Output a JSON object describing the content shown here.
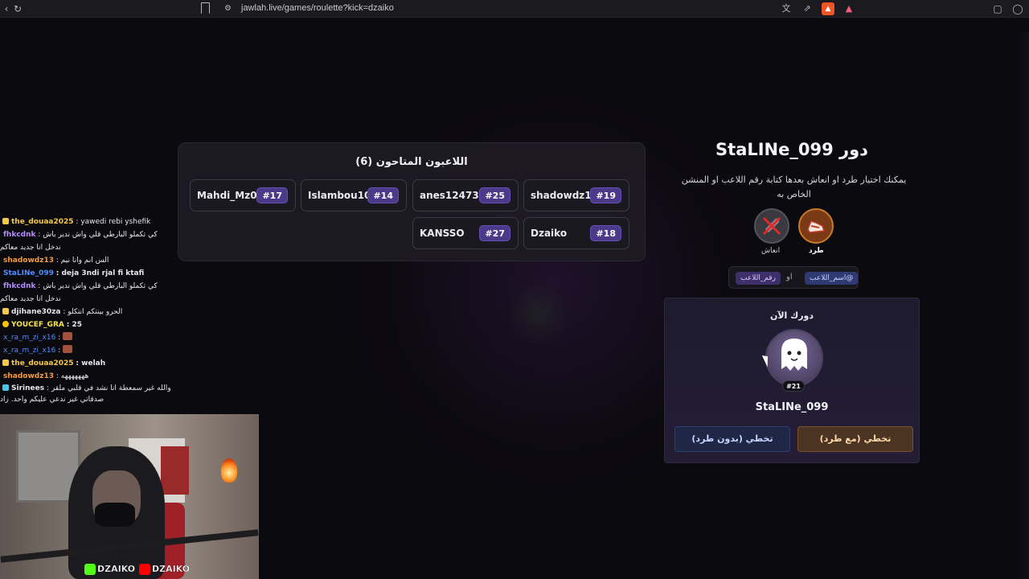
{
  "browser": {
    "url": "jawlah.live/games/roulette?kick=dzaiko"
  },
  "players_panel": {
    "title": "اللاعبون المتاحون (6)",
    "players": [
      {
        "name": "Mahdi_Mz08",
        "number": "#17"
      },
      {
        "name": "Islambou10",
        "number": "#14"
      },
      {
        "name": "anes12473",
        "number": "#25"
      },
      {
        "name": "shadowdz13",
        "number": "#19"
      },
      {
        "name": "KANSSO",
        "number": "#27"
      },
      {
        "name": "Dzaiko",
        "number": "#18"
      }
    ]
  },
  "turn": {
    "title": "دور StaLINe_099",
    "instructions": "يمكنك اختيار طرد او انعاش بعدها كتابة رقم اللاعب او المنشن الخاص به",
    "kick_label": "طرد",
    "revive_label": "انعاش",
    "tag_name": "@اسم_اللاعب",
    "tag_or": "او",
    "tag_number": "رقم_اللاعب",
    "your_turn_label": "دورك الآن",
    "current_player_number": "#21",
    "current_player_name": "StaLINe_099",
    "skip_with_kick": "تخطي (مع طرد)",
    "skip_without_kick": "تخطي (بدون طرد)"
  },
  "chat": [
    {
      "user": "the_douaa2025",
      "text": ": yawedi rebi yshefik",
      "color": "#f7c948",
      "badge": "#f7c948"
    },
    {
      "user": "fhkcdnk",
      "text": ": كي تكملو البارطي قلي واش ندير باش ندخل انا جديد معاكم",
      "color": "#b28cff"
    },
    {
      "user": "shadowdz13",
      "text": ": الس انم وانا نيم",
      "color": "#f59a3a"
    },
    {
      "user": "StaLINe_099",
      "text": ": deja 3ndi rjal fi ktafi",
      "color": "#4f8cff"
    },
    {
      "user": "fhkcdnk",
      "text": ": كي تكملو البارطي قلي واش ندير باش ندخل انا جديد معاكم",
      "color": "#b28cff"
    },
    {
      "user": "djihane30za",
      "text": ": الحرو بينتكم انتكلو",
      "color": "#e6e6e6",
      "badge": "#f7c948"
    },
    {
      "user": "YOUCEF_GRA",
      "text": ": 25",
      "color": "#f7e64a",
      "badge": "#f2c500"
    },
    {
      "user": "x_ra_m_zi_x16",
      "text": ":",
      "color": "#4f8cff",
      "emote": true
    },
    {
      "user": "x_ra_m_zi_x16",
      "text": ":",
      "color": "#4f8cff",
      "emote": true
    },
    {
      "user": "the_douaa2025",
      "text": ": welah",
      "color": "#f7c948",
      "badge": "#f7c948"
    },
    {
      "user": "shadowdz13",
      "text": ": هههههههه",
      "color": "#f59a3a"
    },
    {
      "user": "Sirinees",
      "text": ": والله غير سمعطة انا نشد في قلبي ملقر صدقاتي غير ندعي عليكم واحد. زاد",
      "color": "#e6e6e6",
      "badge": "#49c6e5"
    }
  ],
  "stream_brand": {
    "kick": "DZAIKO",
    "youtube": "DZAIKO"
  }
}
